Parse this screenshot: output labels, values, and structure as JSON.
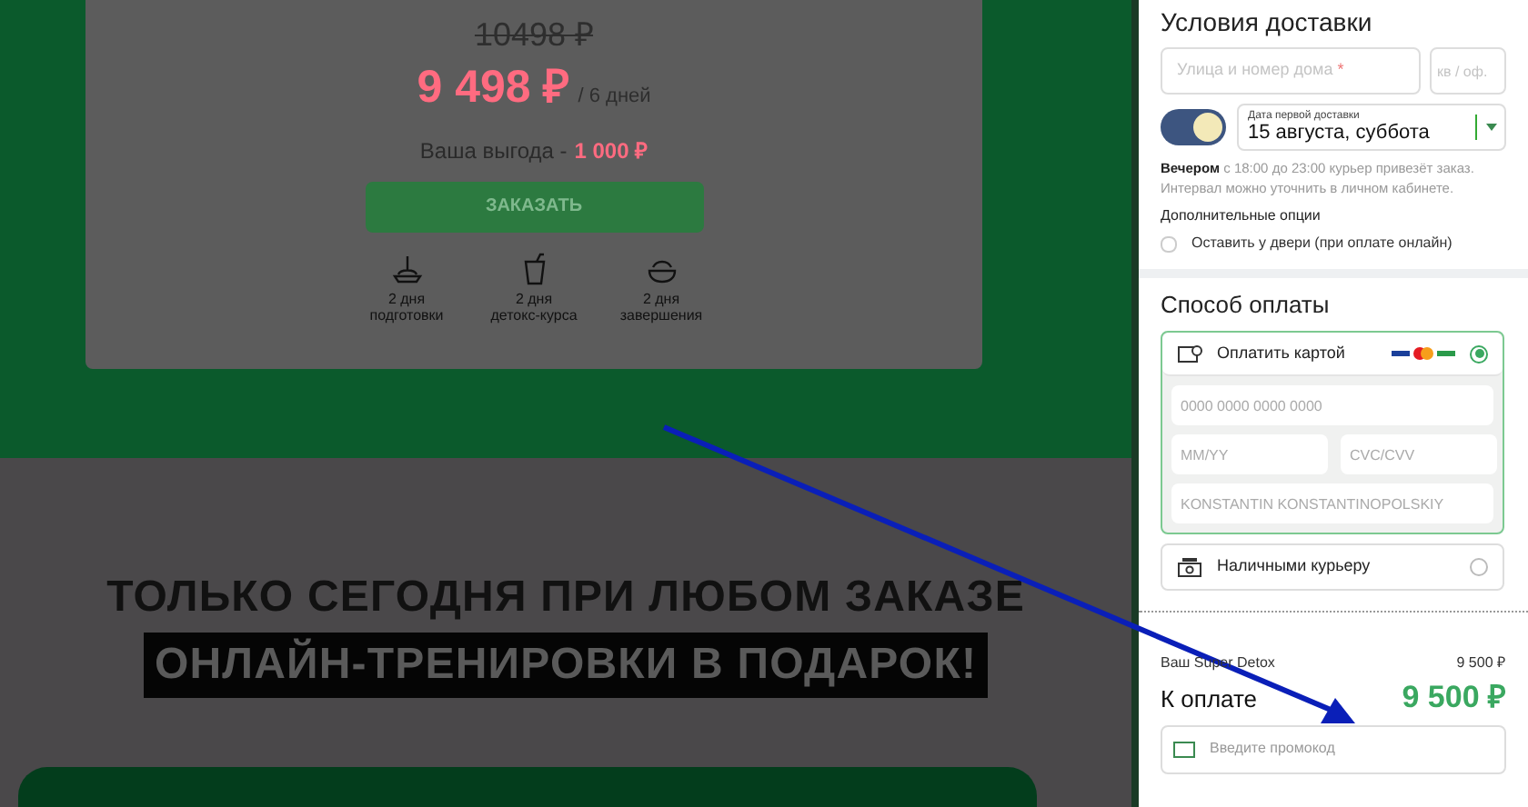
{
  "product_card": {
    "old_price": "10498 ₽",
    "price": "9 498 ₽",
    "period": "/ 6 дней",
    "savings_label": "Ваша выгода -",
    "savings_value": "1 000 ₽",
    "order_button": "ЗАКАЗАТЬ",
    "stages": [
      {
        "kind": "prep",
        "days": "2 дня",
        "label": "подготовки"
      },
      {
        "kind": "detox",
        "days": "2 дня",
        "label": "детокс-курса"
      },
      {
        "kind": "finish",
        "days": "2 дня",
        "label": "завершения"
      }
    ]
  },
  "promo_banner": {
    "line_1": "ТОЛЬКО СЕГОДНЯ ПРИ ЛЮБОМ ЗАКАЗЕ",
    "line_2": "ОНЛАЙН-ТРЕНИРОВКИ В ПОДАРОК!"
  },
  "delivery": {
    "title": "Условия доставки",
    "street_placeholder": "Улица и номер дома",
    "required_mark": "*",
    "apartment_placeholder": "кв / оф.",
    "evening": true,
    "date_label": "Дата первой доставки",
    "date_value": "15 августа, суббота",
    "note": "**Вечером** с 18:00 до 23:00 курьер привезёт заказ. Интервал можно уточнить в личном кабинете.",
    "options_title": "Дополнительные опции",
    "options": [
      {
        "label": "Оставить у двери (при оплате онлайн)",
        "checked": false
      }
    ]
  },
  "payment": {
    "title": "Способ оплаты",
    "methods": [
      {
        "kind": "card",
        "label": "Оплатить картой",
        "selected": true,
        "card_number_placeholder": "0000 0000 0000 0000",
        "expiry_placeholder": "MM/YY",
        "cvc_placeholder": "CVC/CVV",
        "holder_placeholder": "KONSTANTIN KONSTANTINOPOLSKIY"
      },
      {
        "kind": "cash",
        "label": "Наличными курьеру",
        "selected": false
      }
    ]
  },
  "summary": {
    "item_label": "Ваш Super Detox",
    "item_price": "9 500 ₽",
    "total_label": "К оплате",
    "total_value": "9 500 ₽",
    "promo_placeholder": "Введите промокод"
  }
}
